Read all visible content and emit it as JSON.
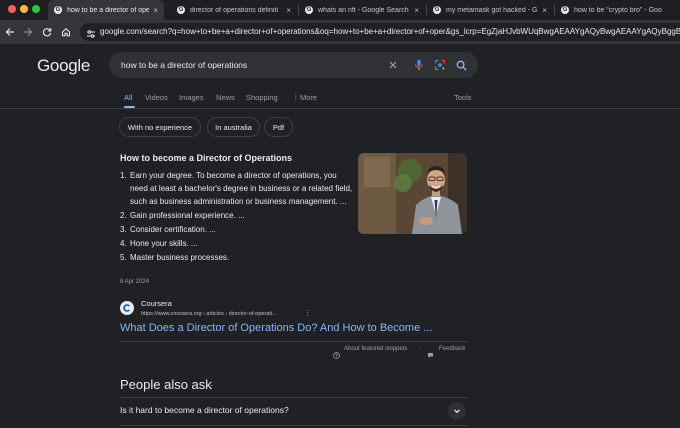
{
  "browser": {
    "tabs": [
      {
        "title": "how to be a director of operat",
        "active": true
      },
      {
        "title": "director of operations definiti",
        "active": false
      },
      {
        "title": "whats an nft - Google Search",
        "active": false
      },
      {
        "title": "my metamask got hacked - G",
        "active": false
      },
      {
        "title": "how to be \"crypto bro\" - Goo",
        "active": false
      }
    ],
    "tab_favicon": "G",
    "tab_close": "×",
    "url": "google.com/search?q=how+to+be+a+director+of+operations&oq=how+to+be+a+director+of+oper&gs_lcrp=EgZjaHJvbWUqBwgAEAAYgAQyBwgAEAAYgAQyBggBEE"
  },
  "google": {
    "logo": "Google",
    "query": "how to be a director of operations",
    "nav": [
      {
        "label": "All",
        "active": true
      },
      {
        "label": "Videos"
      },
      {
        "label": "Images"
      },
      {
        "label": "News"
      },
      {
        "label": "Shopping"
      },
      {
        "label": "More"
      }
    ],
    "tools_label": "Tools",
    "chips": [
      "With no experience",
      "In australia",
      "Pdf"
    ]
  },
  "snippet": {
    "title": "How to become a Director of Operations",
    "steps": [
      {
        "num": "1.",
        "text": "Earn your degree. To become a director of operations, you need at least a bachelor's degree in business or a related field, such as business administration or business management. ..."
      },
      {
        "num": "2.",
        "text": "Gain professional experience. ..."
      },
      {
        "num": "3.",
        "text": "Consider certification. ..."
      },
      {
        "num": "4.",
        "text": "Hone your skills. ..."
      },
      {
        "num": "5.",
        "text": "Master business processes."
      }
    ],
    "date": "8 Apr 2024",
    "source_name": "Coursera",
    "source_url": "https://www.coursera.org › articles › director-of-operati...",
    "link_title": "What Does a Director of Operations Do? And How to Become ...",
    "about_label": "About featured snippets",
    "feedback_label": "Feedback",
    "separator": "·"
  },
  "paa": {
    "title": "People also ask",
    "questions": [
      "Is it hard to become a director of operations?"
    ]
  },
  "colors": {
    "background": "#202124",
    "link": "#8ab4f8",
    "text": "#e8eaed",
    "muted": "#9aa0a6",
    "search_box": "#303134"
  },
  "icons": {
    "back": "back-arrow-icon",
    "forward": "forward-arrow-icon",
    "reload": "reload-icon",
    "home": "home-icon",
    "site_settings": "tune-icon",
    "clear": "close-icon",
    "voice": "microphone-icon",
    "lens": "camera-lens-icon",
    "search": "search-icon",
    "more": "more-vert-icon",
    "expand": "chevron-down-icon"
  }
}
